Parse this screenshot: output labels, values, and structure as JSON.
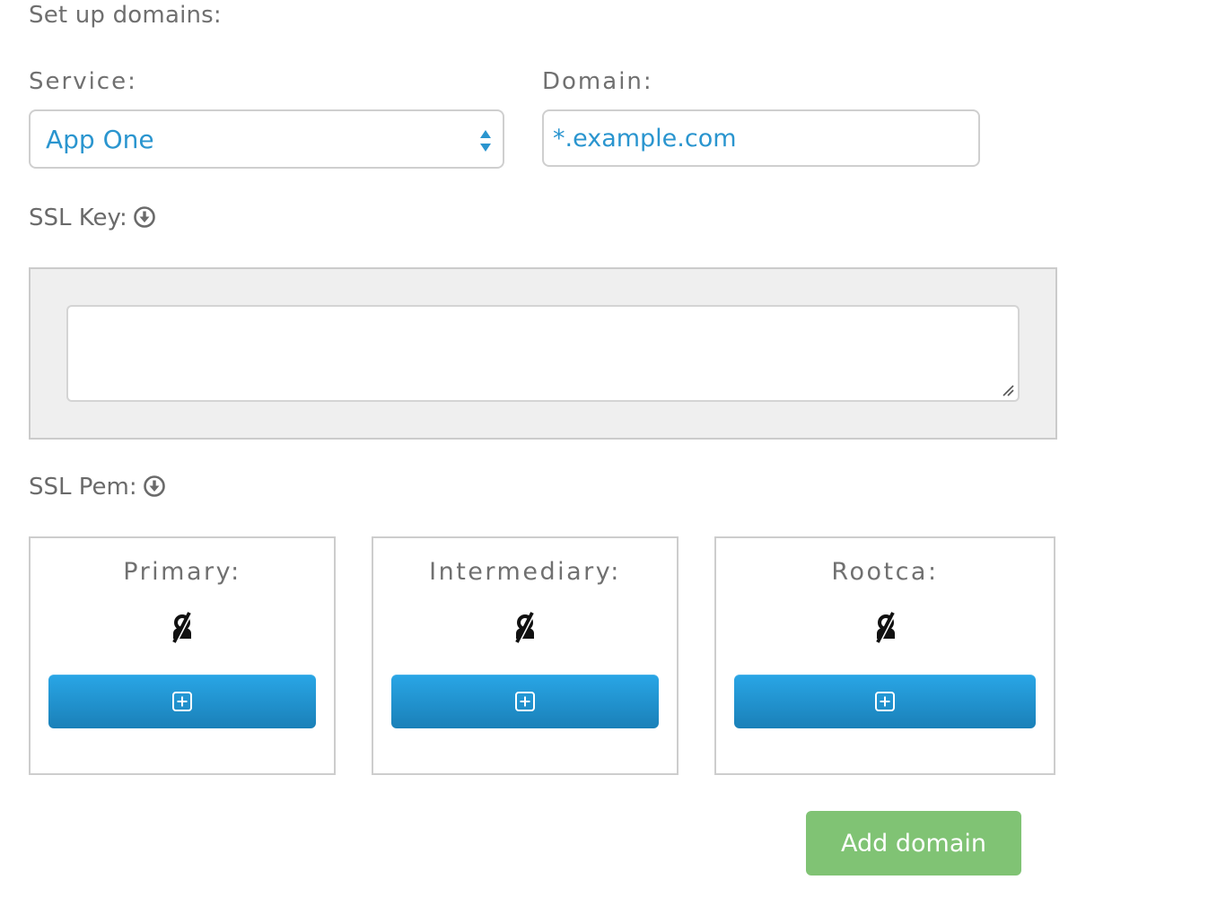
{
  "form": {
    "title": "Set up domains:",
    "service": {
      "label": "Service:",
      "selected": "App One",
      "arrows_icon": "up-down-arrows-icon"
    },
    "domain": {
      "label": "Domain:",
      "value": "*.example.com"
    },
    "ssl_key": {
      "label": "SSL Key:",
      "icon": "download-circle-icon",
      "value": ""
    },
    "ssl_pem": {
      "label": "SSL Pem:",
      "icon": "download-circle-icon",
      "cards": [
        {
          "label": "Primary:",
          "status_icon": "no-certificate-icon",
          "button_icon": "plus-square-icon"
        },
        {
          "label": "Intermediary:",
          "status_icon": "no-certificate-icon",
          "button_icon": "plus-square-icon"
        },
        {
          "label": "Rootca:",
          "status_icon": "no-certificate-icon",
          "button_icon": "plus-square-icon"
        }
      ]
    },
    "submit_label": "Add domain"
  },
  "colors": {
    "accent_text": "#2a95cf",
    "button_blue_top": "#29a6e6",
    "button_blue_bottom": "#1a80b8",
    "submit_green": "#80c374",
    "panel_gray": "#efefef"
  }
}
